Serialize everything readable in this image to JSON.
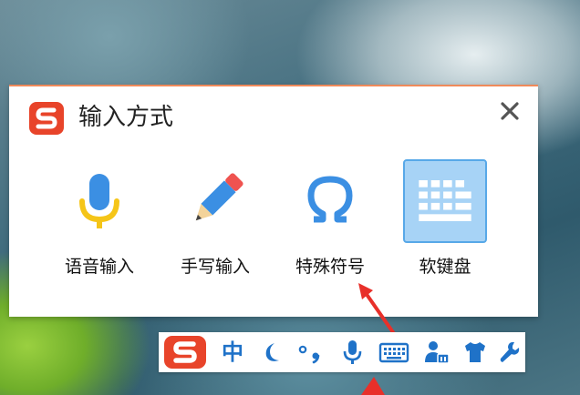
{
  "popup": {
    "title": "输入方式",
    "close_icon": "close-icon",
    "options": [
      {
        "label": "语音输入",
        "icon": "microphone-icon"
      },
      {
        "label": "手写输入",
        "icon": "pencil-icon"
      },
      {
        "label": "特殊符号",
        "icon": "omega-icon"
      },
      {
        "label": "软键盘",
        "icon": "keyboard-icon",
        "selected": true
      }
    ]
  },
  "toolbar": {
    "logo": "sogou-logo",
    "mode_label": "中",
    "items": [
      "sogou-logo",
      "chinese-mode",
      "moon-icon",
      "punctuation-icon",
      "microphone-icon",
      "keyboard-icon",
      "user-icon",
      "shirt-icon",
      "wrench-icon"
    ]
  },
  "colors": {
    "brand_red": "#e8442a",
    "accent_blue": "#1f72c8",
    "selected_bg": "#a7d3f6",
    "mic_yellow": "#f5c518",
    "arrow_red": "#e8302a"
  }
}
